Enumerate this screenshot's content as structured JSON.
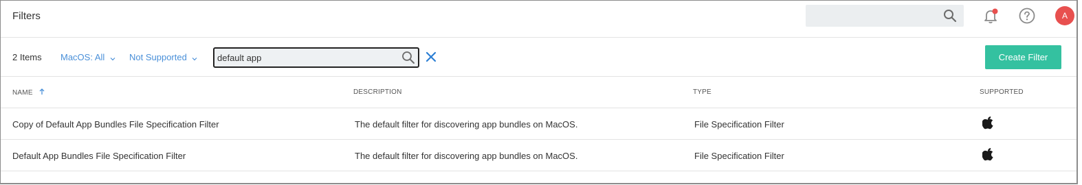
{
  "header": {
    "title": "Filters",
    "search_placeholder": "",
    "avatar_initial": "A",
    "icons": [
      "search-icon",
      "bell-icon",
      "help-icon"
    ],
    "notification_dot_color": "#e8504f"
  },
  "toolbar": {
    "item_count": "2 Items",
    "os_filter": "MacOS: All",
    "support_filter": "Not Supported",
    "search_value": "default app",
    "create_button": "Create Filter",
    "accent_color": "#34c1a0"
  },
  "table": {
    "columns": [
      "NAME",
      "DESCRIPTION",
      "TYPE",
      "SUPPORTED"
    ],
    "sort_column": "NAME",
    "sort_direction": "ascending",
    "rows": [
      {
        "name": "Copy of Default App Bundles File Specification Filter",
        "description": "The default filter for discovering app bundles on MacOS.",
        "type": "File Specification Filter",
        "supported_icon": "apple-icon"
      },
      {
        "name": "Default App Bundles File Specification Filter",
        "description": "The default filter for discovering app bundles on MacOS.",
        "type": "File Specification Filter",
        "supported_icon": "apple-icon"
      }
    ]
  }
}
